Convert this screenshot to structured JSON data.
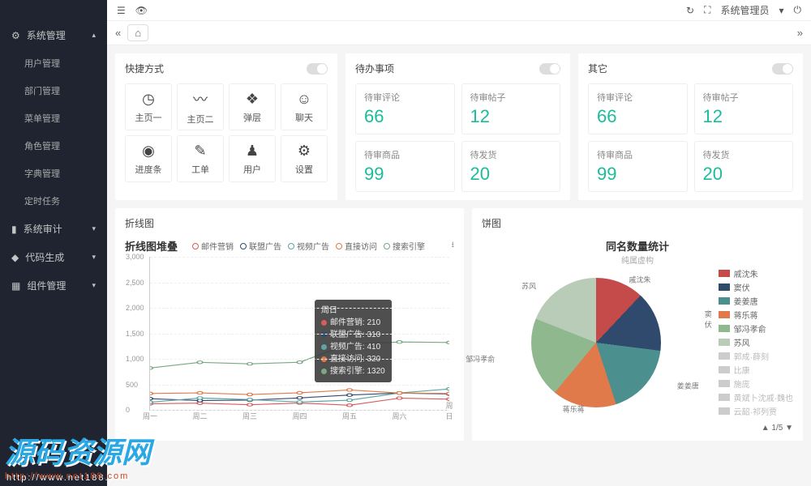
{
  "sidebar": {
    "groups": [
      {
        "icon": "⚙",
        "label": "系统管理",
        "expanded": true,
        "items": [
          "用户管理",
          "部门管理",
          "菜单管理",
          "角色管理",
          "字典管理",
          "定时任务"
        ]
      },
      {
        "icon": "▮",
        "label": "系统审计",
        "expanded": false
      },
      {
        "icon": "◆",
        "label": "代码生成",
        "expanded": false
      },
      {
        "icon": "▦",
        "label": "组件管理",
        "expanded": false
      }
    ]
  },
  "topbar": {
    "user": "系统管理员"
  },
  "cards": {
    "shortcuts": {
      "title": "快捷方式",
      "items": [
        {
          "icon": "◷",
          "label": "主页一"
        },
        {
          "icon": "〰",
          "label": "主页二"
        },
        {
          "icon": "❖",
          "label": "弹层"
        },
        {
          "icon": "☺",
          "label": "聊天"
        },
        {
          "icon": "◉",
          "label": "进度条"
        },
        {
          "icon": "✎",
          "label": "工单"
        },
        {
          "icon": "♟",
          "label": "用户"
        },
        {
          "icon": "⚙",
          "label": "设置"
        }
      ]
    },
    "todo": {
      "title": "待办事项",
      "stats": [
        {
          "label": "待审评论",
          "val": "66"
        },
        {
          "label": "待审帖子",
          "val": "12"
        },
        {
          "label": "待审商品",
          "val": "99"
        },
        {
          "label": "待发货",
          "val": "20"
        }
      ]
    },
    "other": {
      "title": "其它",
      "stats": [
        {
          "label": "待审评论",
          "val": "66"
        },
        {
          "label": "待审帖子",
          "val": "12"
        },
        {
          "label": "待审商品",
          "val": "99"
        },
        {
          "label": "待发货",
          "val": "20"
        }
      ]
    },
    "line": {
      "title": "折线图"
    },
    "pie": {
      "title": "饼图"
    }
  },
  "chart_data": [
    {
      "type": "line",
      "title": "折线图堆叠",
      "categories": [
        "周一",
        "周二",
        "周三",
        "周四",
        "周五",
        "周六",
        "周日"
      ],
      "ylim": [
        0,
        3000
      ],
      "yticks": [
        0,
        500,
        1000,
        1500,
        2000,
        2500,
        3000
      ],
      "series": [
        {
          "name": "邮件营销",
          "color": "#d85c5c",
          "values": [
            120,
            132,
            101,
            134,
            90,
            230,
            210
          ]
        },
        {
          "name": "联盟广告",
          "color": "#334b6c",
          "values": [
            220,
            182,
            191,
            234,
            290,
            330,
            310
          ]
        },
        {
          "name": "视频广告",
          "color": "#5fa3a3",
          "values": [
            150,
            232,
            201,
            154,
            190,
            330,
            410
          ]
        },
        {
          "name": "直接访问",
          "color": "#e07a4a",
          "values": [
            320,
            332,
            301,
            334,
            390,
            330,
            320
          ]
        },
        {
          "name": "搜索引擎",
          "color": "#7aa882",
          "values": [
            820,
            932,
            901,
            934,
            1290,
            1330,
            1320
          ]
        }
      ],
      "tooltip": {
        "cat": "周日",
        "rows": [
          {
            "name": "邮件营销",
            "val": 210,
            "color": "#d85c5c"
          },
          {
            "name": "联盟广告",
            "val": 310,
            "color": "#334b6c"
          },
          {
            "name": "视频广告",
            "val": 410,
            "color": "#5fa3a3"
          },
          {
            "name": "直接访问",
            "val": 320,
            "color": "#e07a4a"
          },
          {
            "name": "搜索引擎",
            "val": 1320,
            "color": "#7aa882"
          }
        ]
      }
    },
    {
      "type": "pie",
      "title": "同名数量统计",
      "subtitle": "纯属虚构",
      "series": [
        {
          "name": "戚沈朱",
          "color": "#c54b4b",
          "value": 12
        },
        {
          "name": "窦伏",
          "color": "#2f4a6c",
          "value": 15
        },
        {
          "name": "姜姜唐",
          "color": "#4b8f8f",
          "value": 18
        },
        {
          "name": "蒋乐蒋",
          "color": "#e07a4a",
          "value": 16
        },
        {
          "name": "邹冯孝俞",
          "color": "#8fb88f",
          "value": 20
        },
        {
          "name": "苏风",
          "color": "#b8ccb8",
          "value": 19
        }
      ],
      "legend_extra": [
        "郭成·薛刻",
        "比康",
        "施庞",
        "黄斌卜沈戚·魏也",
        "云韶·祁列贾"
      ],
      "pager": "1/5"
    }
  ],
  "watermark": {
    "main": "源码资源网",
    "sub": "http://www.net188.com"
  }
}
